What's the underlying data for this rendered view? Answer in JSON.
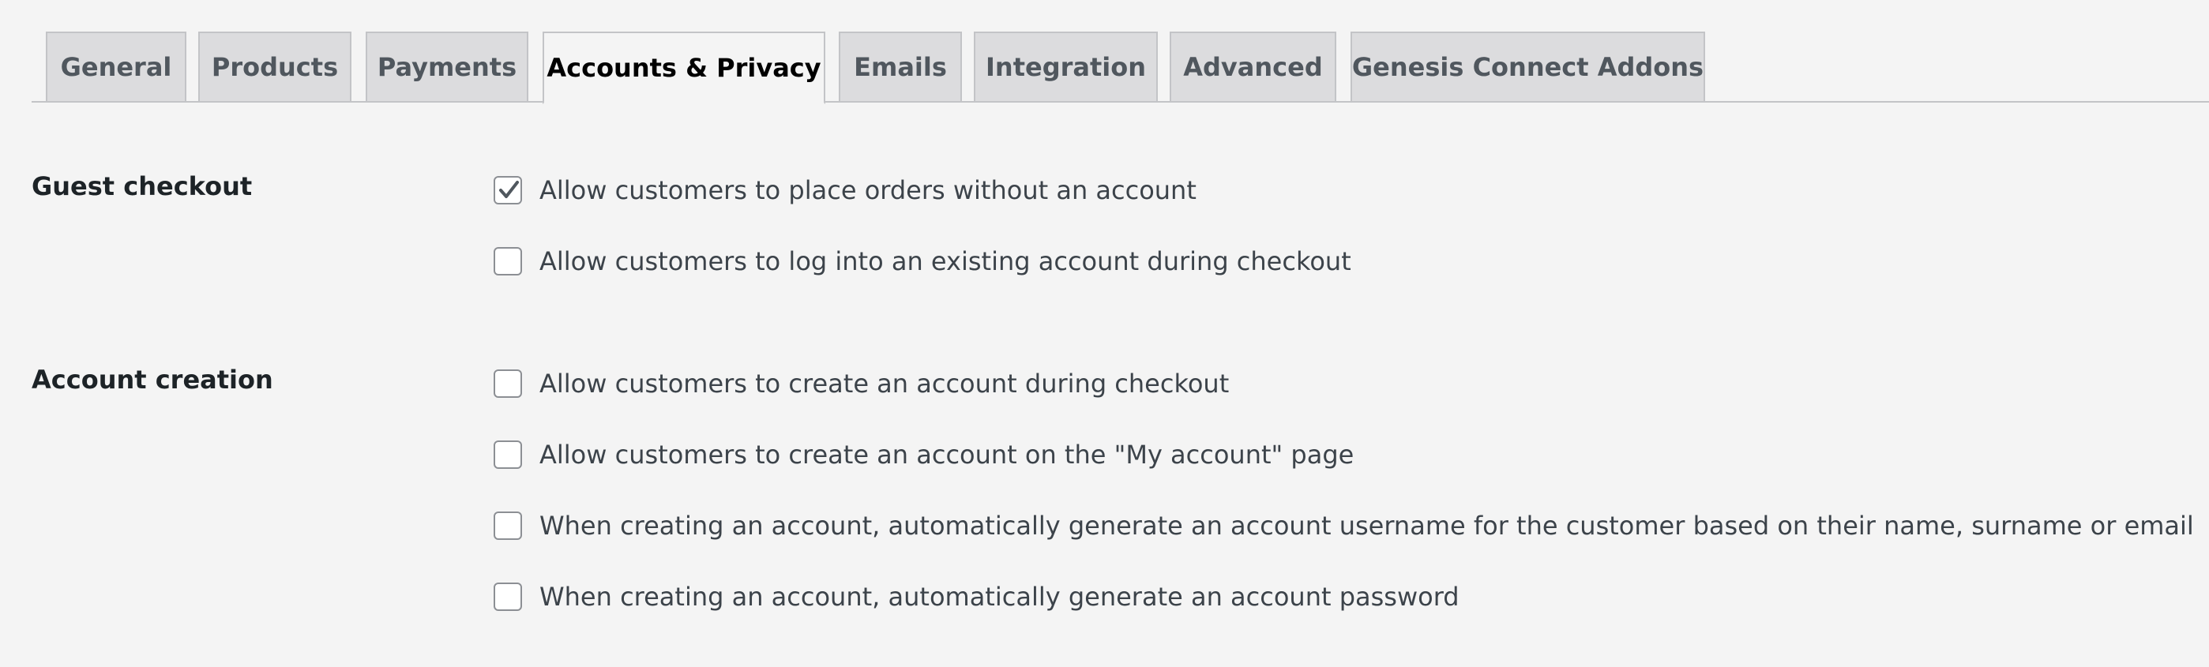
{
  "tabs": [
    {
      "label": "General",
      "active": false
    },
    {
      "label": "Products",
      "active": false
    },
    {
      "label": "Payments",
      "active": false
    },
    {
      "label": "Accounts & Privacy",
      "active": true
    },
    {
      "label": "Emails",
      "active": false
    },
    {
      "label": "Integration",
      "active": false
    },
    {
      "label": "Advanced",
      "active": false
    },
    {
      "label": "Genesis Connect Addons",
      "active": false
    }
  ],
  "guest_checkout": {
    "label": "Guest checkout",
    "options": [
      {
        "label": "Allow customers to place orders without an account",
        "checked": true
      },
      {
        "label": "Allow customers to log into an existing account during checkout",
        "checked": false
      }
    ]
  },
  "account_creation": {
    "label": "Account creation",
    "options": [
      {
        "label": "Allow customers to create an account during checkout",
        "checked": false
      },
      {
        "label": "Allow customers to create an account on the \"My account\" page",
        "checked": false
      },
      {
        "label": "When creating an account, automatically generate an account username for the customer based on their name, surname or email",
        "checked": false
      },
      {
        "label": "When creating an account, automatically generate an account password",
        "checked": false
      }
    ]
  },
  "colors": {
    "background": "#f4f4f4",
    "tab_inactive": "#dcdcde",
    "checkbox_border": "#8c8f94",
    "checkmark": "#50575e"
  },
  "icons": {
    "checkmark": "checkmark-icon"
  }
}
